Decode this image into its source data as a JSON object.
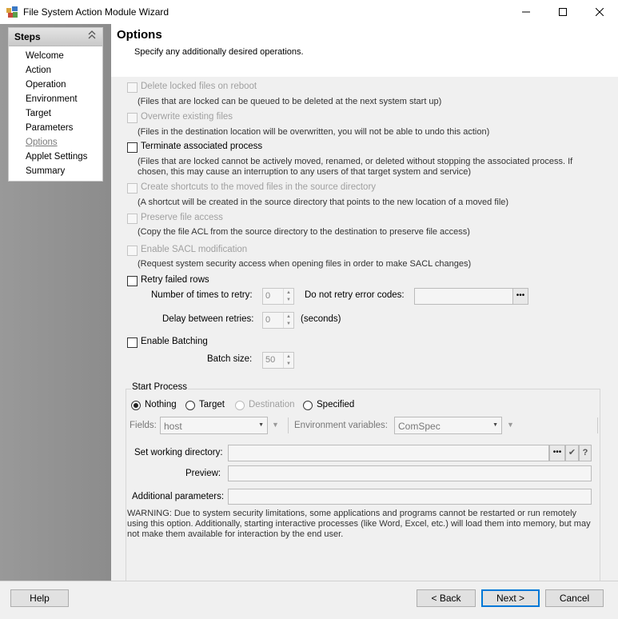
{
  "window": {
    "title": "File System Action Module Wizard",
    "minimize_glyph": "—",
    "maximize_glyph": "☐",
    "close_glyph": "✕"
  },
  "sidebar": {
    "header": "Steps",
    "items": [
      {
        "label": "Welcome"
      },
      {
        "label": "Action"
      },
      {
        "label": "Operation"
      },
      {
        "label": "Environment"
      },
      {
        "label": "Target"
      },
      {
        "label": "Parameters"
      },
      {
        "label": "Options",
        "current": true
      },
      {
        "label": "Applet Settings"
      },
      {
        "label": "Summary"
      }
    ]
  },
  "header": {
    "title": "Options",
    "subtitle": "Specify any additionally desired operations."
  },
  "options": {
    "delete_locked": {
      "label": "Delete locked files on reboot",
      "desc": "(Files that are locked can be queued to be deleted at the next system start up)",
      "checked": false,
      "enabled": false
    },
    "overwrite": {
      "label": "Overwrite existing files",
      "desc": "(Files in the destination location will be overwritten, you will not be able to undo this action)",
      "checked": false,
      "enabled": false
    },
    "terminate": {
      "label": "Terminate associated process",
      "desc": "(Files that are locked cannot be actively moved, renamed, or deleted without stopping the associated process. If chosen, this may cause an interruption to any users of that target system and service)",
      "checked": false,
      "enabled": true
    },
    "shortcuts": {
      "label": "Create shortcuts to the moved files in the source directory",
      "desc": "(A shortcut will be created in the source directory that points to the new location of a moved file)",
      "checked": false,
      "enabled": false
    },
    "preserve": {
      "label": "Preserve file access",
      "desc": "(Copy the file ACL from the source directory to the destination to preserve file access)",
      "checked": false,
      "enabled": false
    },
    "sacl": {
      "label": "Enable SACL modification",
      "desc": "(Request system security access when opening files in order to make SACL changes)",
      "checked": false,
      "enabled": false
    },
    "retry": {
      "label": "Retry failed rows",
      "checked": false,
      "times_label": "Number of times to retry:",
      "times_value": "0",
      "no_retry_label": "Do not retry error codes:",
      "no_retry_value": "",
      "delay_label": "Delay between retries:",
      "delay_value": "0",
      "delay_unit": "(seconds)"
    },
    "batching": {
      "label": "Enable Batching",
      "checked": false,
      "size_label": "Batch size:",
      "size_value": "50"
    }
  },
  "start_process": {
    "group_label": "Start Process",
    "radios": [
      {
        "label": "Nothing",
        "selected": true,
        "enabled": true
      },
      {
        "label": "Target",
        "selected": false,
        "enabled": true
      },
      {
        "label": "Destination",
        "selected": false,
        "enabled": false
      },
      {
        "label": "Specified",
        "selected": false,
        "enabled": true
      }
    ],
    "fields_label": "Fields:",
    "fields_value": "host",
    "env_label": "Environment variables:",
    "env_value": "ComSpec",
    "workdir_label": "Set working directory:",
    "workdir_value": "",
    "preview_label": "Preview:",
    "preview_value": "",
    "params_label": "Additional parameters:",
    "params_value": "",
    "warning": "WARNING: Due to system security limitations, some applications and programs cannot be restarted or run remotely using this option. Additionally, starting interactive processes (like Word, Excel, etc.) will load them into memory, but may not make them available for interaction by the end user."
  },
  "footer": {
    "help": "Help",
    "back": "< Back",
    "next": "Next >",
    "cancel": "Cancel"
  }
}
